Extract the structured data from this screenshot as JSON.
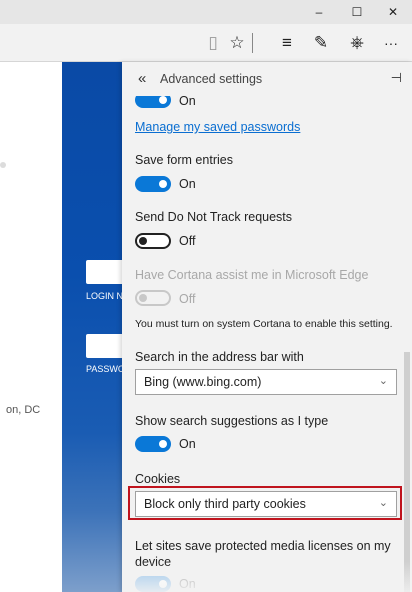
{
  "window": {
    "minimize": "–",
    "maximize": "☐",
    "close": "✕"
  },
  "toolbar": {
    "icons": [
      "reading-view-icon",
      "favorite-star-icon",
      "hub-icon",
      "web-note-icon",
      "share-icon",
      "more-icon"
    ],
    "reading_view": "▯",
    "favorite": "☆",
    "hub": "≡",
    "web_note": "✎",
    "share": "⎈",
    "more": "···"
  },
  "background_page": {
    "login_label": "LOGIN NAME",
    "password_label": "PASSWORD",
    "city_text": "on, DC"
  },
  "pane": {
    "back_glyph": "«",
    "title": "Advanced settings",
    "pin_glyph": "⊣",
    "top_toggle_text": "On",
    "manage_passwords_link": "Manage my saved passwords",
    "save_form_entries": {
      "label": "Save form entries",
      "state": "On"
    },
    "do_not_track": {
      "label": "Send Do Not Track requests",
      "state": "Off"
    },
    "cortana": {
      "label": "Have Cortana assist me in Microsoft Edge",
      "state": "Off",
      "note": "You must turn on system Cortana to enable this setting."
    },
    "search_engine": {
      "label": "Search in the address bar with",
      "value": "Bing (www.bing.com)"
    },
    "search_suggestions": {
      "label": "Show search suggestions as I type",
      "state": "On"
    },
    "cookies": {
      "label": "Cookies",
      "value": "Block only third party cookies"
    },
    "media_licenses": {
      "label": "Let sites save protected media licenses on my device",
      "state": "On"
    }
  },
  "colors": {
    "toggle_on": "#0a78d7",
    "link": "#0a6ed1",
    "highlight": "#c0141e",
    "background_blue": "#0a4aa6"
  }
}
